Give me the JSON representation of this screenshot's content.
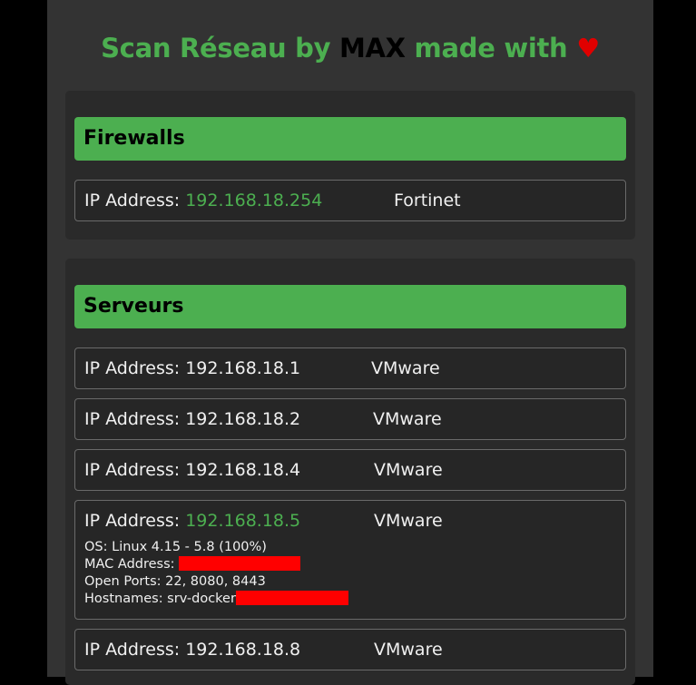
{
  "title": {
    "part1": "Scan Réseau by",
    "author": "MAX",
    "part2": "made with",
    "heart": "♥"
  },
  "sections": [
    {
      "heading": "Firewalls",
      "devices": [
        {
          "ip_label": "IP Address:",
          "ip": "192.168.18.254",
          "vendor": "Fortinet",
          "highlight": true
        }
      ]
    },
    {
      "heading": "Serveurs",
      "devices": [
        {
          "ip_label": "IP Address:",
          "ip": "192.168.18.1",
          "vendor": "VMware",
          "highlight": false
        },
        {
          "ip_label": "IP Address:",
          "ip": "192.168.18.2",
          "vendor": "VMware",
          "highlight": false
        },
        {
          "ip_label": "IP Address:",
          "ip": "192.168.18.4",
          "vendor": "VMware",
          "highlight": false
        },
        {
          "ip_label": "IP Address:",
          "ip": "192.168.18.5",
          "vendor": "VMware",
          "highlight": true,
          "details": {
            "os": "OS: Linux 4.15 - 5.8 (100%)",
            "mac_label": "MAC Address:",
            "ports": "Open Ports: 22, 8080, 8443",
            "hostnames_label": "Hostnames: srv-docker"
          }
        },
        {
          "ip_label": "IP Address:",
          "ip": "192.168.18.8",
          "vendor": "VMware",
          "highlight": false
        }
      ]
    }
  ],
  "colors": {
    "accent": "#4caf50",
    "redaction": "#ff0000",
    "heart": "#e00000"
  }
}
